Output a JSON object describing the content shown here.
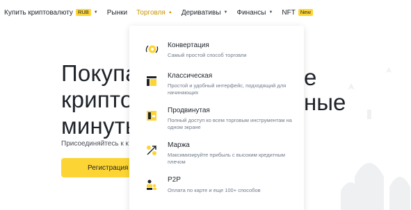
{
  "nav": {
    "items": [
      {
        "label": "Купить криптовалюту",
        "badge": "RUB"
      },
      {
        "label": "Рынки"
      },
      {
        "label": "Торговля"
      },
      {
        "label": "Деривативы"
      },
      {
        "label": "Финансы"
      },
      {
        "label": "NFT",
        "badge": "New"
      }
    ]
  },
  "hero": {
    "title_lines": [
      "Покупа",
      "крипто",
      "минуты"
    ],
    "title_right": [
      "е",
      "ные"
    ],
    "subtitle": "Присоединяйтесь к к",
    "cta_label": "Регистрация"
  },
  "dropdown": {
    "items": [
      {
        "title": "Конвертация",
        "desc": "Самый простой способ торговли",
        "icon": "convert-icon"
      },
      {
        "title": "Классическая",
        "desc": "Простой и удобный интерфейс, подходящий для начинающих",
        "icon": "classic-layout-icon"
      },
      {
        "title": "Продвинутая",
        "desc": "Полный доступ ко всем торговым инструментам на одном экране",
        "icon": "advanced-layout-icon"
      },
      {
        "title": "Маржа",
        "desc": "Максимизируйте прибыль с высоким кредитным плечом",
        "icon": "margin-icon"
      },
      {
        "title": "P2P",
        "desc": "Оплата по карте и еще 100+ способов",
        "icon": "p2p-icon"
      }
    ]
  },
  "colors": {
    "accent": "#fcd535",
    "active": "#c99400",
    "text": "#1e2329",
    "muted": "#707a8a"
  }
}
